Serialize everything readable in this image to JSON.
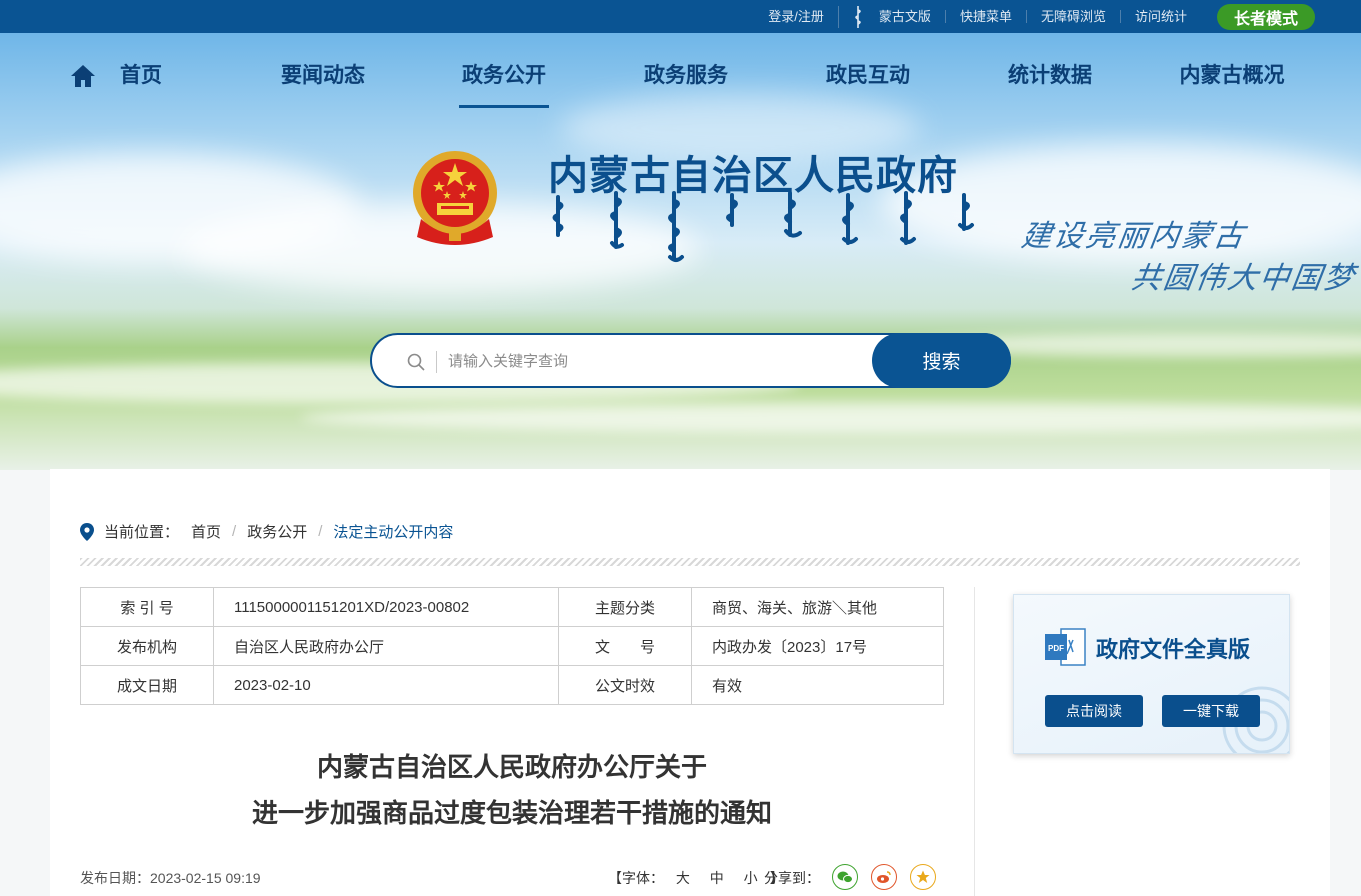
{
  "topbar": {
    "links": [
      "登录/注册",
      "蒙古文版",
      "快捷菜单",
      "无障碍浏览",
      "访问统计"
    ],
    "elder_mode": "长者模式",
    "bg_color": "#0a5493",
    "elder_color": "#3b9a26"
  },
  "nav": {
    "items": [
      "首页",
      "要闻动态",
      "政务公开",
      "政务服务",
      "政民互动",
      "统计数据",
      "内蒙古概况"
    ],
    "active": "政务公开"
  },
  "header": {
    "title": "内蒙古自治区人民政府",
    "slogan_line1": "建设亮丽内蒙古",
    "slogan_line2": "共圆伟大中国梦"
  },
  "search": {
    "placeholder": "请输入关键字查询",
    "button": "搜索"
  },
  "breadcrumb": {
    "label": "当前位置：",
    "items": [
      "首页",
      "政务公开",
      "法定主动公开内容"
    ]
  },
  "meta_table": [
    {
      "k1": "索 引 号",
      "v1": "1115000001151201XD/2023-00802",
      "k2": "主题分类",
      "v2": "商贸、海关、旅游＼其他"
    },
    {
      "k1": "发布机构",
      "v1": "自治区人民政府办公厅",
      "k2": "文　　号",
      "v2": "内政办发〔2023〕17号"
    },
    {
      "k1": "成文日期",
      "v1": "2023-02-10",
      "k2": "公文时效",
      "v2": "有效"
    }
  ],
  "pdf_box": {
    "title": "政府文件全真版",
    "read_button": "点击阅读",
    "download_button": "一键下载"
  },
  "document": {
    "title_line1": "内蒙古自治区人民政府办公厅关于",
    "title_line2": "进一步加强商品过度包装治理若干措施的通知",
    "publish_date": "发布日期：2023-02-15 09:19",
    "font_size_label": "【字体：",
    "font_sizes": [
      "大",
      "中",
      "小"
    ],
    "font_size_end": "】",
    "share_label": "分享到："
  },
  "share_icons": [
    "wechat-icon",
    "weibo-icon",
    "favorite-icon"
  ],
  "colors": {
    "primary": "#0a5493",
    "title": "#0b4f8d",
    "wechat": "#3ea32e",
    "weibo": "#e0552a",
    "star": "#e9a81b"
  }
}
